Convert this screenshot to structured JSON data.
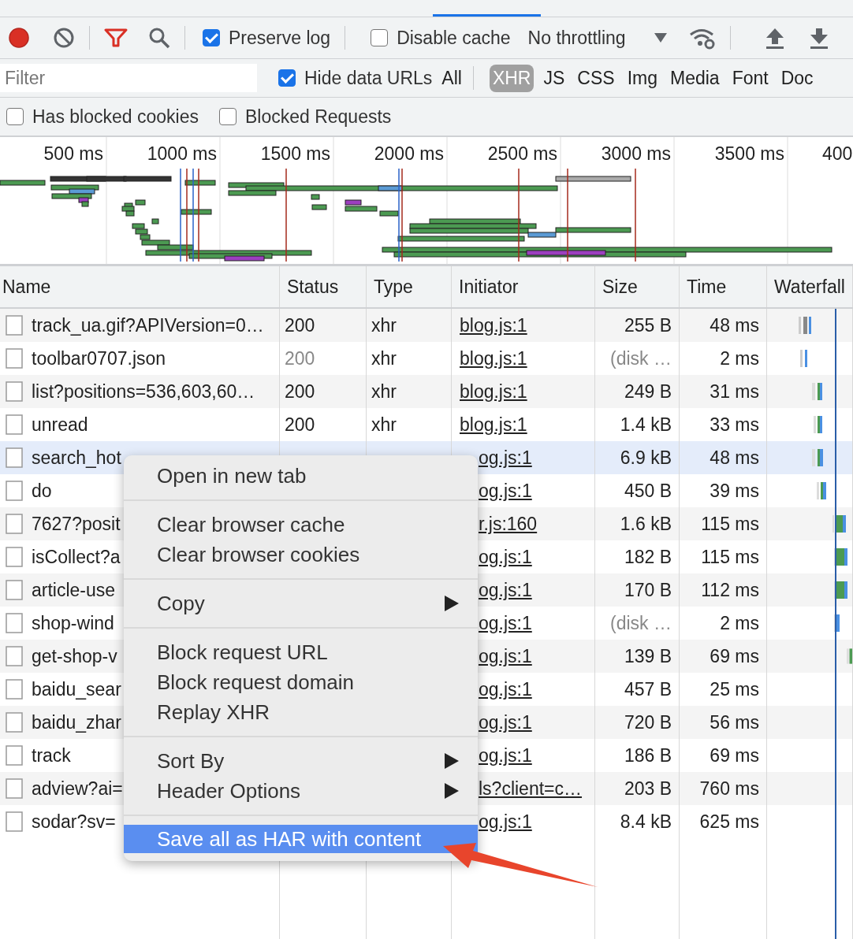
{
  "toolbar": {
    "preserve_log": {
      "label": "Preserve log",
      "checked": true
    },
    "disable_cache": {
      "label": "Disable cache",
      "checked": false
    },
    "throttling": {
      "value": "No throttling"
    }
  },
  "filter_bar": {
    "filter": {
      "placeholder": "Filter"
    },
    "hide_data_urls": {
      "label": "Hide data URLs",
      "checked": true
    },
    "types": [
      {
        "label": "All",
        "selected": false
      },
      {
        "label": "XHR",
        "selected": true
      },
      {
        "label": "JS",
        "selected": false
      },
      {
        "label": "CSS",
        "selected": false
      },
      {
        "label": "Img",
        "selected": false
      },
      {
        "label": "Media",
        "selected": false
      },
      {
        "label": "Font",
        "selected": false
      },
      {
        "label": "Doc",
        "selected": false
      }
    ]
  },
  "options": [
    {
      "label": "Has blocked cookies",
      "checked": false
    },
    {
      "label": "Blocked Requests",
      "checked": false
    }
  ],
  "overview": {
    "ticks": [
      "500 ms",
      "1000 ms",
      "1500 ms",
      "2000 ms",
      "2500 ms",
      "3000 ms",
      "3500 ms",
      "400"
    ]
  },
  "table": {
    "columns": [
      "Name",
      "Status",
      "Type",
      "Initiator",
      "Size",
      "Time",
      "Waterfall"
    ],
    "rows": [
      {
        "name": "track_ua.gif?APIVersion=0…",
        "status": "200",
        "type": "xhr",
        "initiator": "blog.js:1",
        "size": "255 B",
        "time": "48 ms",
        "from_cache": false,
        "hovered": false,
        "covered": false
      },
      {
        "name": "toolbar0707.json",
        "status": "200",
        "type": "xhr",
        "initiator": "blog.js:1",
        "size": "(disk …",
        "time": "2 ms",
        "from_cache": true,
        "hovered": false,
        "covered": false
      },
      {
        "name": "list?positions=536,603,60…",
        "status": "200",
        "type": "xhr",
        "initiator": "blog.js:1",
        "size": "249 B",
        "time": "31 ms",
        "from_cache": false,
        "hovered": false,
        "covered": false
      },
      {
        "name": "unread",
        "status": "200",
        "type": "xhr",
        "initiator": "blog.js:1",
        "size": "1.4 kB",
        "time": "33 ms",
        "from_cache": false,
        "hovered": false,
        "covered": false
      },
      {
        "name": "search_hot",
        "initiator": "og.js:1",
        "size": "6.9 kB",
        "time": "48 ms",
        "from_cache": false,
        "hovered": true,
        "covered": true
      },
      {
        "name": "do",
        "initiator": "og.js:1",
        "size": "450 B",
        "time": "39 ms",
        "from_cache": false,
        "hovered": false,
        "covered": true
      },
      {
        "name": "7627?posit",
        "initiator": "r.js:160",
        "size": "1.6 kB",
        "time": "115 ms",
        "from_cache": false,
        "hovered": false,
        "covered": true
      },
      {
        "name": "isCollect?a",
        "initiator": "og.js:1",
        "size": "182 B",
        "time": "115 ms",
        "from_cache": false,
        "hovered": false,
        "covered": true
      },
      {
        "name": "article-use",
        "initiator": "og.js:1",
        "size": "170 B",
        "time": "112 ms",
        "from_cache": false,
        "hovered": false,
        "covered": true
      },
      {
        "name": "shop-wind",
        "initiator": "og.js:1",
        "size": "(disk …",
        "time": "2 ms",
        "from_cache": true,
        "hovered": false,
        "covered": true
      },
      {
        "name": "get-shop-v",
        "initiator": "og.js:1",
        "size": "139 B",
        "time": "69 ms",
        "from_cache": false,
        "hovered": false,
        "covered": true
      },
      {
        "name": "baidu_sear",
        "initiator": "og.js:1",
        "size": "457 B",
        "time": "25 ms",
        "from_cache": false,
        "hovered": false,
        "covered": true
      },
      {
        "name": "baidu_zhar",
        "initiator": "og.js:1",
        "size": "720 B",
        "time": "56 ms",
        "from_cache": false,
        "hovered": false,
        "covered": true
      },
      {
        "name": "track",
        "initiator": "og.js:1",
        "size": "186 B",
        "time": "69 ms",
        "from_cache": false,
        "hovered": false,
        "covered": true
      },
      {
        "name": "adview?ai=",
        "initiator": "ls?client=c…",
        "size": "203 B",
        "time": "760 ms",
        "from_cache": false,
        "hovered": false,
        "covered": true
      },
      {
        "name": "sodar?sv=",
        "initiator": "og.js:1",
        "size": "8.4 kB",
        "time": "625 ms",
        "from_cache": false,
        "hovered": false,
        "covered": true
      }
    ]
  },
  "context_menu": {
    "groups": [
      [
        {
          "label": "Open in new tab",
          "submenu": false,
          "highlighted": false
        }
      ],
      [
        {
          "label": "Clear browser cache",
          "submenu": false,
          "highlighted": false
        },
        {
          "label": "Clear browser cookies",
          "submenu": false,
          "highlighted": false
        }
      ],
      [
        {
          "label": "Copy",
          "submenu": true,
          "highlighted": false
        }
      ],
      [
        {
          "label": "Block request URL",
          "submenu": false,
          "highlighted": false
        },
        {
          "label": "Block request domain",
          "submenu": false,
          "highlighted": false
        },
        {
          "label": "Replay XHR",
          "submenu": false,
          "highlighted": false
        }
      ],
      [
        {
          "label": "Sort By",
          "submenu": true,
          "highlighted": false
        },
        {
          "label": "Header Options",
          "submenu": true,
          "highlighted": false
        }
      ],
      [
        {
          "label": "Save all as HAR with content",
          "submenu": false,
          "highlighted": true
        }
      ]
    ]
  }
}
